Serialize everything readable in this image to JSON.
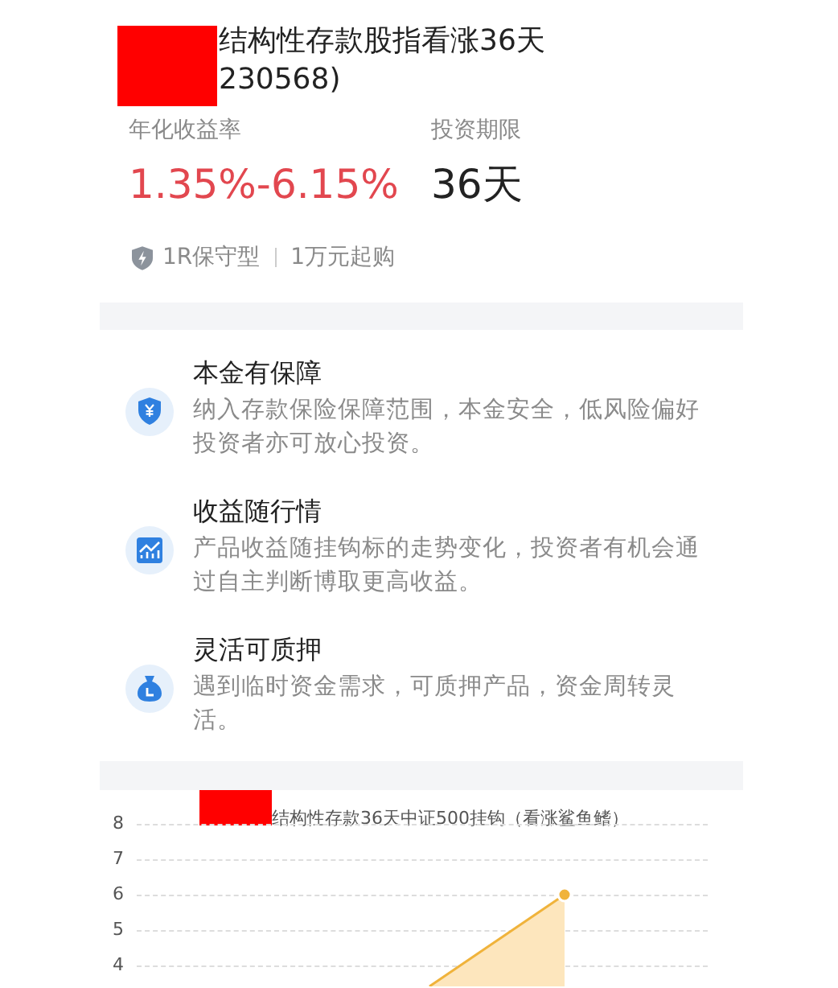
{
  "product": {
    "title_lines": [
      "结构性存款股指看涨36天",
      "230568)"
    ],
    "redacted": true
  },
  "metrics": [
    {
      "label": "年化收益率",
      "value": "1.35%-6.15%",
      "kind": "rate"
    },
    {
      "label": "投资期限",
      "value": "36天",
      "kind": "term"
    }
  ],
  "tags": [
    "1R保守型",
    "1万元起购"
  ],
  "features": [
    {
      "kind": "shield",
      "title": "本金有保障",
      "text": "纳入存款保险保障范围，本金安全，低风险偏好投资者亦可放心投资。"
    },
    {
      "kind": "trend",
      "title": "收益随行情",
      "text": "产品收益随挂钩标的走势变化，投资者有机会通过自主判断博取更高收益。"
    },
    {
      "kind": "pledge",
      "title": "灵活可质押",
      "text": "遇到临时资金需求，可质押产品，资金周转灵活。"
    }
  ],
  "chart": {
    "title": "结构性存款36天中证500挂钩（看涨鲨鱼鳍）",
    "redacted": true,
    "yticks": [
      "8",
      "7",
      "6",
      "5",
      "4"
    ]
  }
}
